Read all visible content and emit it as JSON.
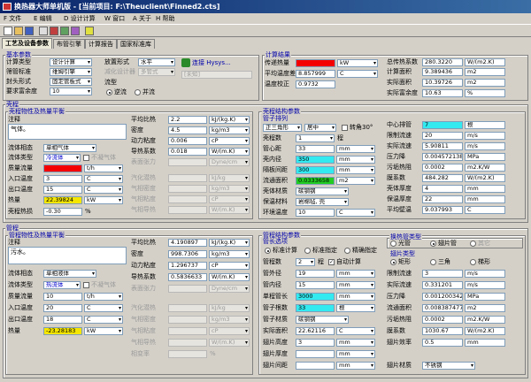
{
  "window": {
    "title": "换热器大师单机版 - [当前项目: F:\\Theuclient\\Finned2.cts]"
  },
  "menu": {
    "file": "F 文件",
    "edit": "E 编辑",
    "design": "D 设计计算",
    "window": "W 窗口",
    "about": "A 关于",
    "help": "H 帮助"
  },
  "tabs": [
    "工艺及设备参数",
    "布管引擎",
    "计算报告",
    "国家标准库"
  ],
  "basic": {
    "title": "基本参数",
    "calc_type_label": "计算类型",
    "calc_type": "设计计算",
    "standard_label": "筛管标准",
    "standard": "维姆引擎",
    "seal_label": "封头形式",
    "seal": "固定管板式",
    "req_label": "要求富余度",
    "req": "10",
    "unit_label": "热量单位",
    "unit": "%",
    "arrange_label": "放置形式",
    "arrange": "水平",
    "nozzle_label": "减化设计器",
    "nozzle": "多管式",
    "flow_label": "流型",
    "flow_co": "逆流",
    "flow_para": "并流",
    "connect_btn": "连接 Hysys...",
    "unconnected": "[未知]"
  },
  "result": {
    "title": "计算结果",
    "duty_label": "传递热量",
    "duty": "",
    "duty_unit": "kW",
    "lmtd_label": "平均温度差",
    "lmtd": "8.857999",
    "lmtd_unit": "C",
    "corr_label": "温度校正",
    "corr": "0.9732",
    "U_label": "总传热系数",
    "U": "280.3220",
    "U_unit": "W/(m2.K)",
    "area_label": "计算面积",
    "area": "9.389436",
    "area_unit": "m2",
    "act_area_label": "实际面积",
    "act_area": "10.39726",
    "act_area_unit": "m2",
    "margin_label": "实际富余度",
    "margin": "10.63",
    "margin_unit": "%"
  },
  "shell": {
    "title": "壳程",
    "sub": "壳程物性及热量平衡",
    "notes_label": "注释",
    "notes": "气体。",
    "state_label": "流体相态",
    "state": "单相气体",
    "medium_label": "流体类型",
    "medium": "冷流体",
    "medium_note": "不凝气体",
    "flow_label": "质量流量",
    "flow": "",
    "flow_unit": "t/h",
    "tin_label": "入口温度",
    "tin": "3",
    "tin_unit": "C",
    "tout_label": "出口温度",
    "tout": "15",
    "tout_unit": "C",
    "q_label": "热量",
    "q": "22.39824",
    "q_unit": "kW",
    "fouling_label": "壳程热损",
    "fouling": "-0.30",
    "fouling_unit": "%",
    "cp_label": "平均比热",
    "cp": "2.2",
    "cp_unit": "kJ/(kg.K)",
    "rho_label": "密度",
    "rho": "4.5",
    "rho_unit": "kg/m3",
    "mu_label": "动力粘度",
    "mu": "0.006",
    "mu_unit": "cP",
    "k_label": "导热系数",
    "k": "0.018",
    "k_unit": "W/(m.K)",
    "sigma_label": "表面张力",
    "sigma": "",
    "sigma_unit": "Dyne/cm",
    "latent_label": "汽化潜热",
    "latent": "",
    "latent_unit": "kJ/kg",
    "rho2_label": "气相密度",
    "rho2": "",
    "rho2_unit": "kg/m3",
    "mu2_label": "气相粘度",
    "mu2": "",
    "mu2_unit": "cP",
    "k2_label": "气相导热",
    "k2": "",
    "k2_unit": "W/(m.K)",
    "x_label": "相变率",
    "x": "",
    "x_unit": "%"
  },
  "shellstruct": {
    "title": "壳程结构参数",
    "layout_label": "管子排列",
    "layout": "正三角形",
    "layout2": "居中",
    "rotate": "转角30°",
    "passes_label": "壳程数",
    "passes": "1",
    "passes_unit": "程",
    "od_label": "管心距",
    "od": "33",
    "od_unit": "mm",
    "id_label": "壳内径",
    "id": "350",
    "id_unit": "mm",
    "baffle_label": "隔板间距",
    "baffle": "300",
    "baffle_unit": "mm",
    "flow_area_label": "流通面积",
    "flow_area": "0.0333658",
    "flow_area_unit": "m2",
    "mat_label": "壳体材质",
    "mat": "碳钢钢",
    "ins_label": "保温材料",
    "ins": "岩棉毡, 壳",
    "env_label": "环境温度",
    "env": "10",
    "env_unit": "C",
    "center_label": "中心排管",
    "center": "7",
    "center_unit": "根",
    "lim_label": "限制流速",
    "lim": "20",
    "lim_unit": "m/s",
    "vel_label": "实际流速",
    "vel": "5.90811",
    "vel_unit": "m/s",
    "dp_label": "压力降",
    "dp": "0.004572138",
    "dp_unit": "MPa",
    "foul_label": "污垢热阻",
    "foul": "0.0002",
    "foul_unit": "m2.K/W",
    "h_label": "膜系数",
    "h": "484.282",
    "h_unit": "W/(m2.K)",
    "wall_label": "壳体厚度",
    "wall": "4",
    "wall_unit": "mm",
    "insth_label": "保温厚度",
    "insth": "22",
    "insth_unit": "mm",
    "tw_label": "平均壁温",
    "tw": "9.037993",
    "tw_unit": "C"
  },
  "tube": {
    "title": "管程",
    "sub": "管程物性及热量平衡",
    "notes_label": "注释",
    "notes": "污水。",
    "state_label": "流体相态",
    "state": "单相液体",
    "medium_label": "流体类型",
    "medium": "热流体",
    "medium_note": "不凝气体",
    "flow_label": "质量流量",
    "flow": "10",
    "flow_unit": "t/h",
    "tin_label": "入口温度",
    "tin": "20",
    "tin_unit": "C",
    "tout_label": "出口温度",
    "tout": "18",
    "tout_unit": "C",
    "q_label": "热量",
    "q": "-23.28183",
    "q_unit": "kW",
    "cp_label": "平均比热",
    "cp": "4.190897",
    "cp_unit": "kJ/(kg.K)",
    "rho_label": "密度",
    "rho": "998.7306",
    "rho_unit": "kg/m3",
    "mu_label": "动力粘度",
    "mu": "1.296737",
    "mu_unit": "cP",
    "k_label": "导热系数",
    "k": "0.5836633",
    "k_unit": "W/(m.K)",
    "sigma_label": "表面张力",
    "sigma": "",
    "sigma_unit": "Dyne/cm",
    "latent_label": "汽化潜热",
    "latent": "",
    "latent_unit": "kJ/kg",
    "rho2_label": "气相密度",
    "rho2": "",
    "rho2_unit": "kg/m3",
    "mu2_label": "气相粘度",
    "mu2": "",
    "mu2_unit": "cP",
    "k2_label": "气相导热",
    "k2": "",
    "k2_unit": "W/(m.K)",
    "x_label": "相变率",
    "x": "",
    "x_unit": "%"
  },
  "tubestruct": {
    "title": "管程结构参数",
    "len_group": "管长选项",
    "len_std": "标准计算",
    "len_spec": "标准指定",
    "len_exact": "精确指定",
    "passes_label": "管程数",
    "passes": "2",
    "passes_unit": "程",
    "auto": "自动计算",
    "od_label": "管外径",
    "od": "19",
    "od_unit": "mm",
    "th_label": "管内径",
    "th": "15",
    "th_unit": "mm",
    "len_label": "单程管长",
    "len": "3000",
    "len_unit": "mm",
    "count_label": "管子根数",
    "count": "33",
    "count_unit": "根",
    "mat_label": "管子材质",
    "mat": "碳钢钢",
    "area_label": "实际面积",
    "area": "22.62116",
    "area_unit": "C",
    "fin_h_label": "翅片高度",
    "fin_h": "3",
    "fin_h_unit": "mm",
    "fin_t_label": "翅片厚度",
    "fin_t": "",
    "fin_t_unit": "mm",
    "fin_p_label": "翅片间距",
    "fin_p": "",
    "fin_p_unit": "mm",
    "lim_label": "限制流速",
    "lim": "3",
    "lim_unit": "m/s",
    "vel_label": "实际流速",
    "vel": "0.331201",
    "vel_unit": "m/s",
    "dp_label": "压力降",
    "dp": "0.001200342",
    "dp_unit": "MPa",
    "flow_area_label": "流通面积",
    "flow_area": "0.008387477",
    "flow_area_unit": "m2",
    "foul_label": "污垢热阻",
    "foul": "0.0002",
    "foul_unit": "m2.K/W",
    "h_label": "膜系数",
    "h": "1030.67",
    "h_unit": "W/(m2.K)",
    "eff_label": "翅片效率",
    "eff": "0.5",
    "eff_unit": "mm",
    "fin_mat_label": "翅片材质",
    "fin_mat": "不锈钢"
  },
  "exch": {
    "title": "换热管类型",
    "opt1": "光管",
    "opt2": "翅片管",
    "opt3": "其它",
    "fin_title": "翅片类型",
    "fin1": "矩形",
    "fin2": "三角",
    "fin3": "梯形"
  }
}
